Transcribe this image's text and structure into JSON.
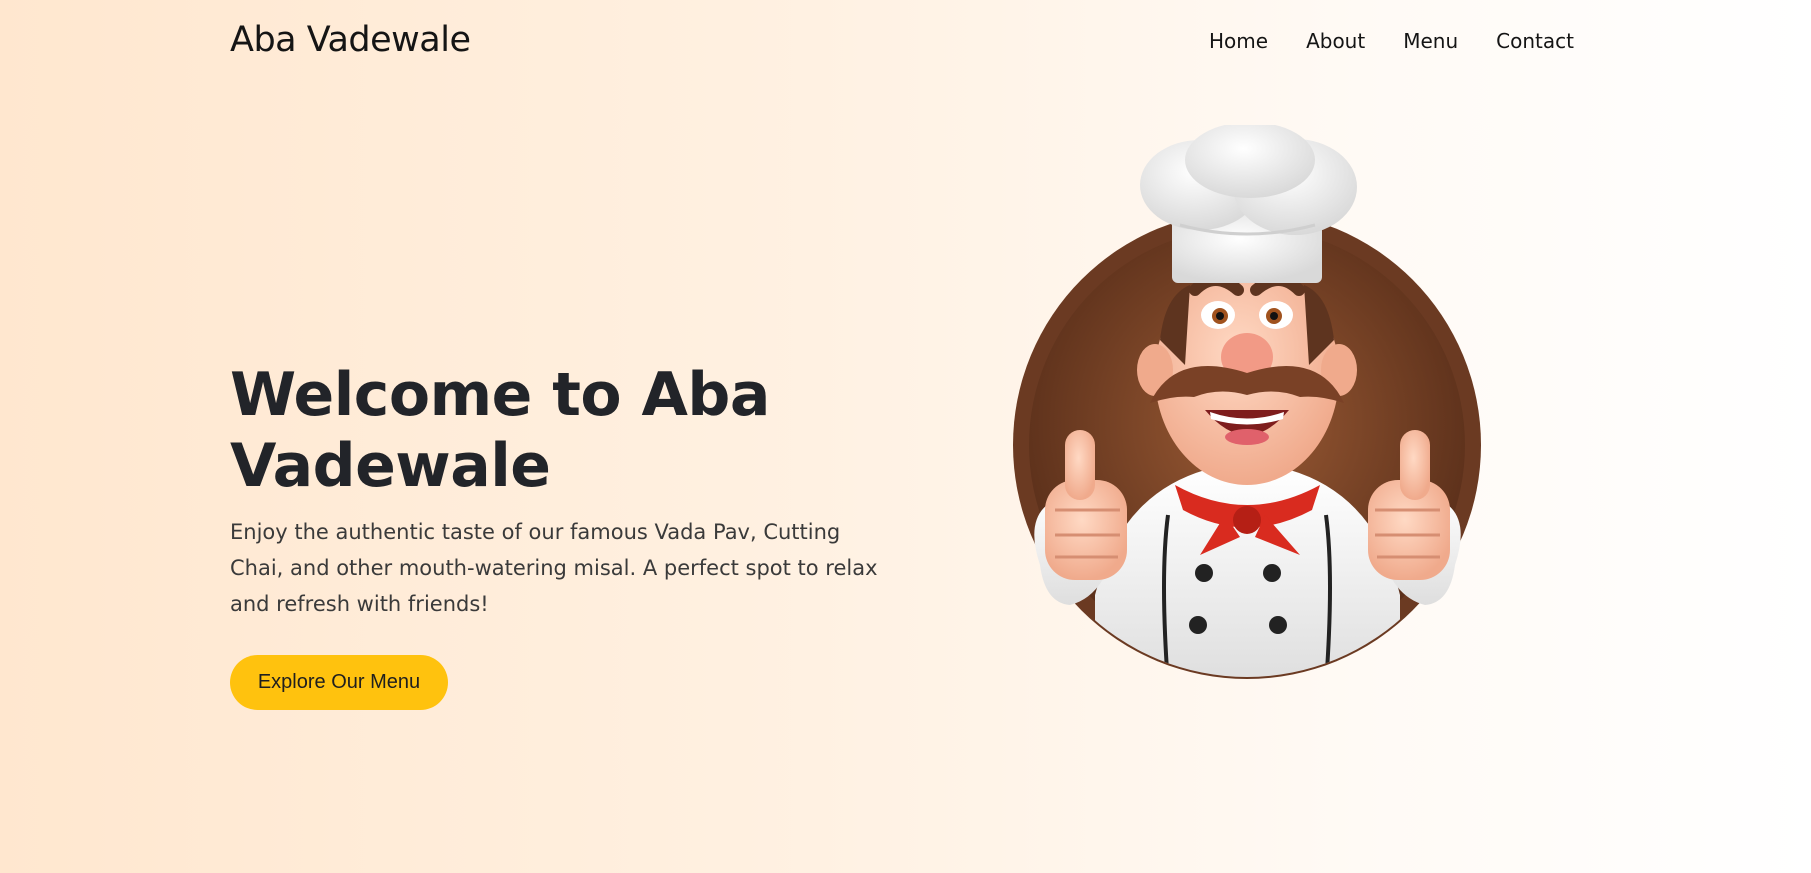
{
  "brand": {
    "name": "Aba Vadewale"
  },
  "nav": {
    "links": [
      {
        "label": "Home"
      },
      {
        "label": "About"
      },
      {
        "label": "Menu"
      },
      {
        "label": "Contact"
      }
    ]
  },
  "hero": {
    "title": "Welcome to Aba Vadewale",
    "description": "Enjoy the authentic taste of our famous Vada Pav, Cutting Chai, and other mouth-watering misal. A perfect spot to relax and refresh with friends!",
    "cta_label": "Explore Our Menu"
  },
  "illustration": {
    "icon": "chef-thumbs-up-icon"
  },
  "colors": {
    "accent": "#ffc20e",
    "background_left": "#ffe7cf",
    "background_right": "#ffffff",
    "heading": "#222429",
    "medallion": "#6b3a22"
  }
}
